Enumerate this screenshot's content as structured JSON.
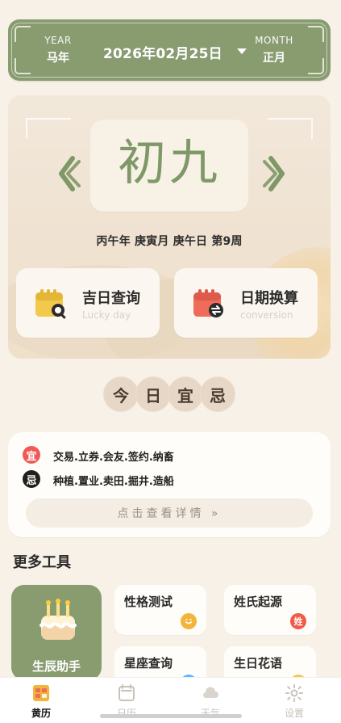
{
  "header": {
    "year_label": "YEAR",
    "year_value": "马年",
    "date": "2026年02月25日",
    "month_label": "MONTH",
    "month_value": "正月"
  },
  "hero": {
    "lunar_day": "初九",
    "ganzhi": "丙午年 庚寅月 庚午日 第9周",
    "tools": [
      {
        "title": "吉日查询",
        "subtitle": "Lucky day",
        "icon": "calendar-search-icon",
        "color": "#f2c94c"
      },
      {
        "title": "日期换算",
        "subtitle": "conversion",
        "icon": "calendar-convert-icon",
        "color": "#ef6b5a"
      }
    ]
  },
  "yiji": {
    "chars": [
      "今",
      "日",
      "宜",
      "忌"
    ],
    "yi_badge": "宜",
    "ji_badge": "忌",
    "yi_text": "交易.立券.会友.签约.纳畜",
    "ji_text": "种植.置业.卖田.掘井.造船",
    "more": "点击查看详情 »"
  },
  "more_tools": {
    "title": "更多工具",
    "big": {
      "label": "生辰助手",
      "icon": "birthday-cake-icon"
    },
    "items": [
      {
        "title": "性格测试",
        "badge_text": "",
        "icon": "smile-icon",
        "color": "#f2b43b"
      },
      {
        "title": "姓氏起源",
        "badge_text": "姓",
        "icon": "surname-icon",
        "color": "#f05b45"
      },
      {
        "title": "星座查询",
        "badge_text": "",
        "icon": "zodiac-icon",
        "color": "#62b7ff"
      },
      {
        "title": "生日花语",
        "badge_text": "",
        "icon": "flower-icon",
        "color": "#f2c94c"
      }
    ]
  },
  "bottom_nav": {
    "items": [
      {
        "label": "黄历",
        "icon": "almanac-icon",
        "active": true
      },
      {
        "label": "日历",
        "icon": "calendar-icon",
        "active": false
      },
      {
        "label": "天气",
        "icon": "weather-icon",
        "active": false
      },
      {
        "label": "设置",
        "icon": "settings-icon",
        "active": false
      }
    ],
    "active_color": "#111111",
    "inactive_color": "#c9c2b9"
  }
}
